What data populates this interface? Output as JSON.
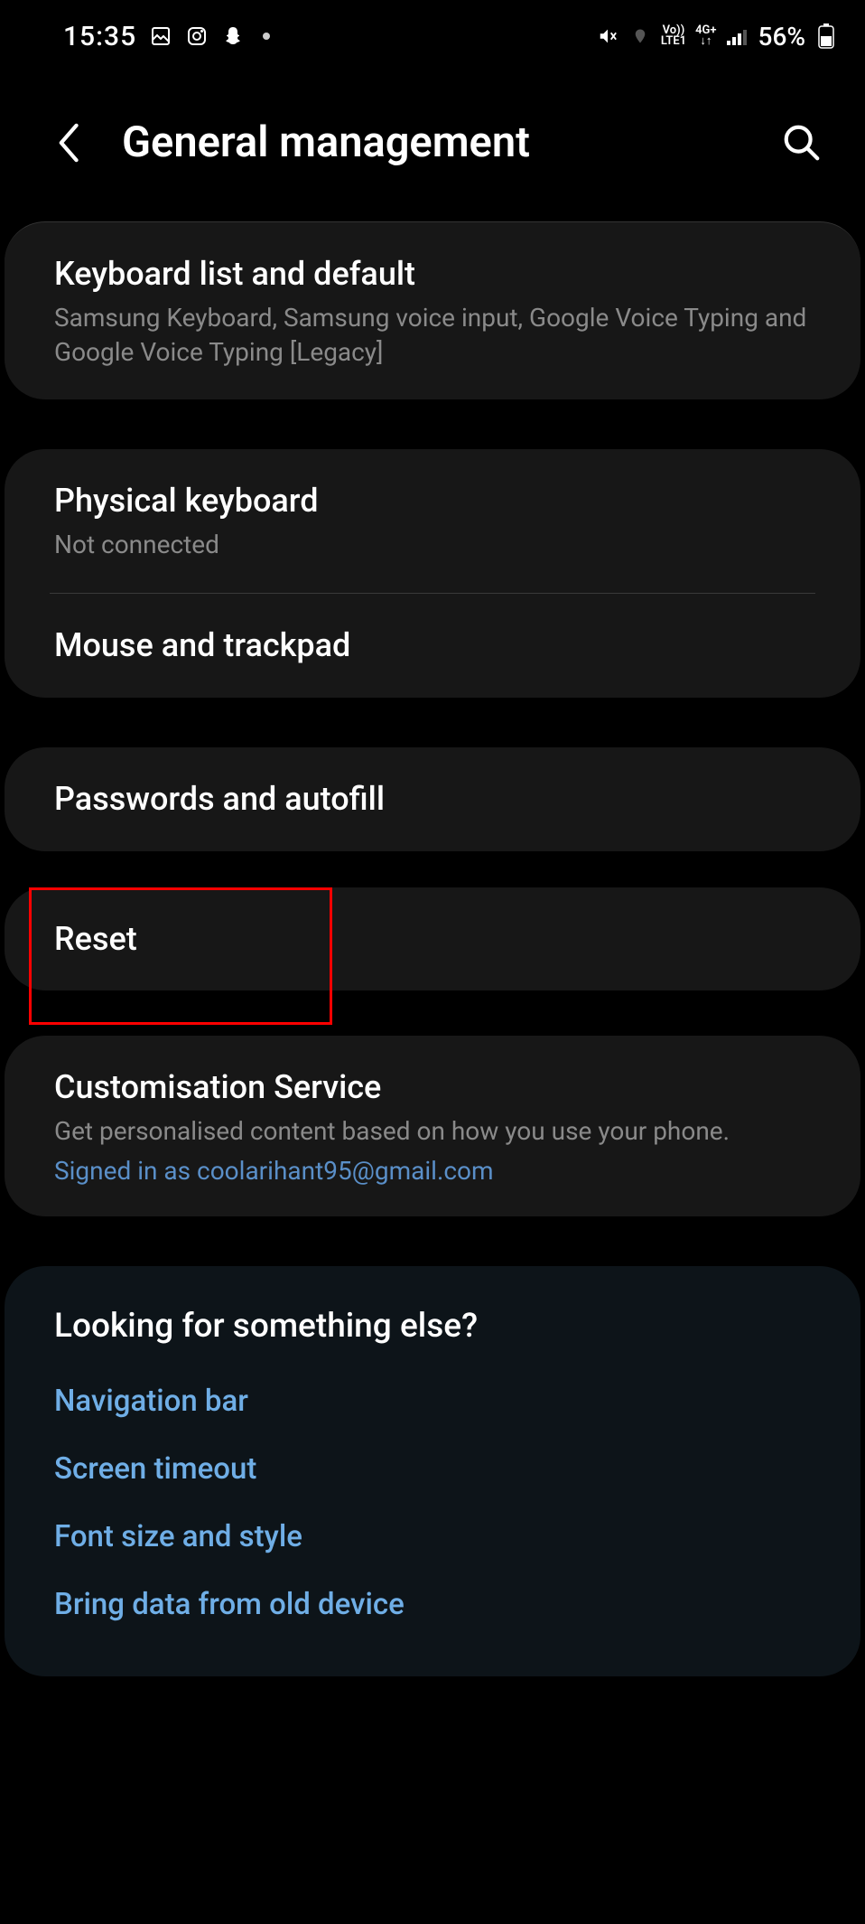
{
  "statusBar": {
    "time": "15:35",
    "batteryText": "56%",
    "networkText1": "Vo))",
    "networkText2": "LTE1",
    "networkText3": "4G+"
  },
  "header": {
    "title": "General management"
  },
  "items": {
    "keyboardList": {
      "title": "Keyboard list and default",
      "sub": "Samsung Keyboard, Samsung voice input, Google Voice Typing and Google Voice Typing [Legacy]"
    },
    "physicalKeyboard": {
      "title": "Physical keyboard",
      "sub": "Not connected"
    },
    "mouseTrackpad": {
      "title": "Mouse and trackpad"
    },
    "passwordsAutofill": {
      "title": "Passwords and autofill"
    },
    "reset": {
      "title": "Reset"
    },
    "customisation": {
      "title": "Customisation Service",
      "sub": "Get personalised content based on how you use your phone.",
      "signedIn": "Signed in as coolarihant95@gmail.com"
    }
  },
  "lookingFor": {
    "title": "Looking for something else?",
    "links": {
      "nav": "Navigation bar",
      "screen": "Screen timeout",
      "font": "Font size and style",
      "bring": "Bring data from old device"
    }
  }
}
